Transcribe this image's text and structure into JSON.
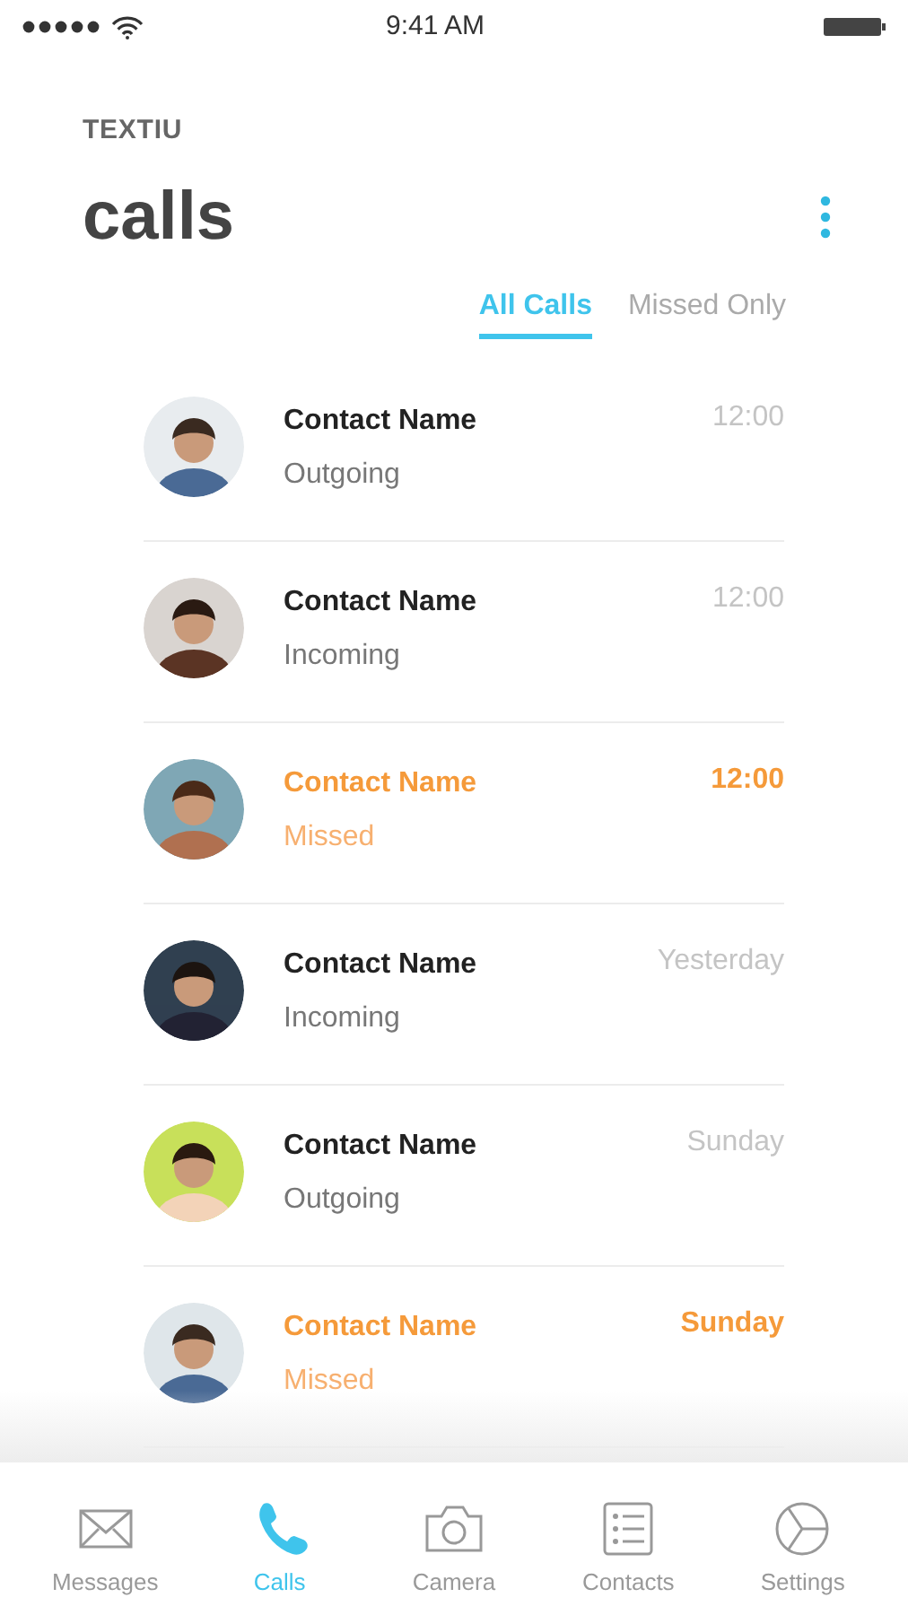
{
  "status_bar": {
    "time": "9:41 AM"
  },
  "header": {
    "app_name": "TEXTIU",
    "title": "calls"
  },
  "tabs": [
    {
      "label": "All Calls",
      "selected": true
    },
    {
      "label": "Missed Only",
      "selected": false
    }
  ],
  "calls": [
    {
      "name": "Contact Name",
      "type": "Outgoing",
      "time": "12:00",
      "missed": false
    },
    {
      "name": "Contact Name",
      "type": "Incoming",
      "time": "12:00",
      "missed": false
    },
    {
      "name": "Contact Name",
      "type": "Missed",
      "time": "12:00",
      "missed": true
    },
    {
      "name": "Contact Name",
      "type": "Incoming",
      "time": "Yesterday",
      "missed": false
    },
    {
      "name": "Contact Name",
      "type": "Outgoing",
      "time": "Sunday",
      "missed": false
    },
    {
      "name": "Contact Name",
      "type": "Missed",
      "time": "Sunday",
      "missed": true
    }
  ],
  "nav": [
    {
      "label": "Messages",
      "kind": "envelope",
      "selected": false
    },
    {
      "label": "Calls",
      "kind": "phone",
      "selected": true
    },
    {
      "label": "Camera",
      "kind": "camera",
      "selected": false
    },
    {
      "label": "Contacts",
      "kind": "list",
      "selected": false
    },
    {
      "label": "Settings",
      "kind": "pie",
      "selected": false
    }
  ]
}
